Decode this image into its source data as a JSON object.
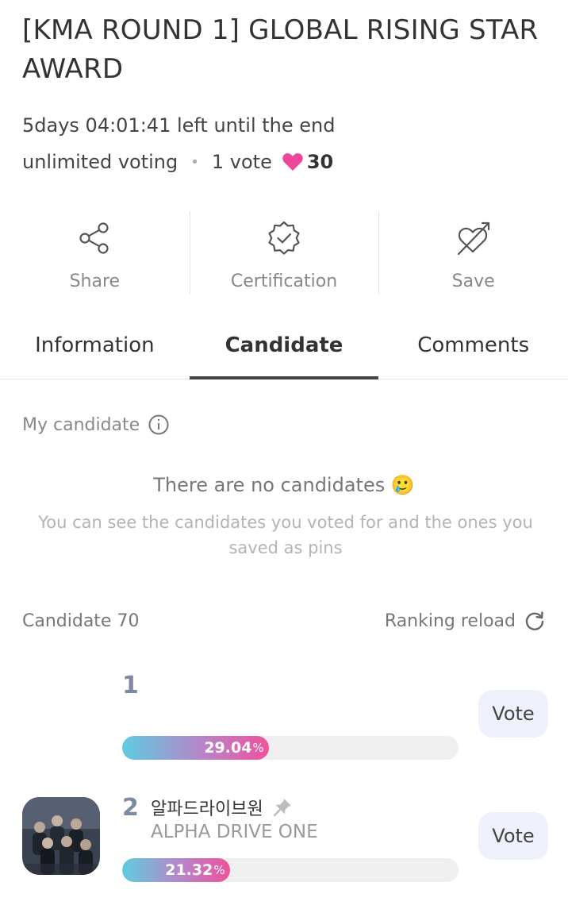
{
  "event": {
    "title": "[KMA ROUND 1] GLOBAL RISING STAR AWARD",
    "time_left": "5days 04:01:41 left until the end",
    "voting_mode": "unlimited voting",
    "vote_rule": "1 vote",
    "heart_count": "30"
  },
  "actions": {
    "share": "Share",
    "certification": "Certification",
    "save": "Save"
  },
  "tabs": {
    "information": "Information",
    "candidate": "Candidate",
    "comments": "Comments",
    "active": "Candidate"
  },
  "my_candidate": {
    "label": "My candidate",
    "empty_title": "There are no candidates 🥲",
    "empty_sub": "You can see the candidates you voted for and the ones you saved as pins"
  },
  "candidates": {
    "count_label": "Candidate 70",
    "reload_label": "Ranking reload",
    "list": [
      {
        "rank": "1",
        "name_ko": "",
        "name_en": "",
        "percent": 29.04,
        "percent_value": "29.04",
        "percent_sign": "%",
        "vote_label": "Vote"
      },
      {
        "rank": "2",
        "name_ko": "알파드라이브원",
        "name_en": "ALPHA DRIVE ONE",
        "percent": 21.32,
        "percent_value": "21.32",
        "percent_sign": "%",
        "vote_label": "Vote"
      }
    ]
  },
  "colors": {
    "heart": "#f0469a",
    "bar_start": "#5ecce0",
    "bar_end": "#f0529c",
    "rank": "#7d8aa5",
    "vote_button_bg": "#eef1fb"
  }
}
